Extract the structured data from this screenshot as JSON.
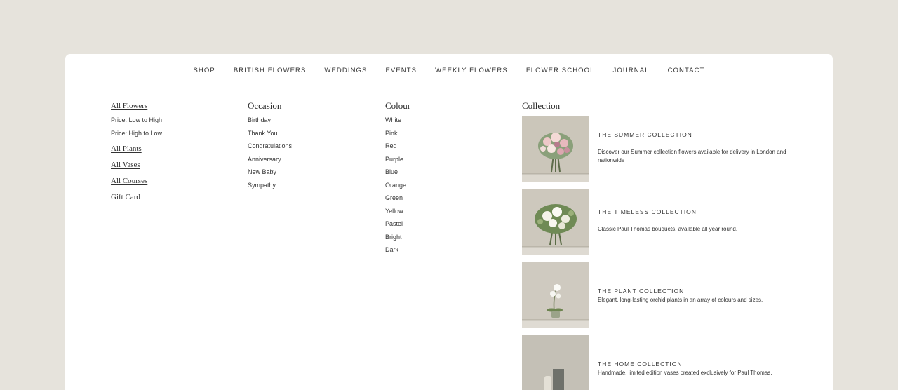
{
  "nav": [
    "SHOP",
    "BRITISH FLOWERS",
    "WEDDINGS",
    "EVENTS",
    "WEEKLY FLOWERS",
    "FLOWER SCHOOL",
    "JOURNAL",
    "CONTACT"
  ],
  "col1": {
    "all_flowers": "All Flowers",
    "sort": [
      "Price: Low to High",
      "Price: High to Low"
    ],
    "links": [
      "All Plants",
      "All Vases",
      "All Courses",
      "Gift Card"
    ]
  },
  "occasion": {
    "heading": "Occasion",
    "items": [
      "Birthday",
      "Thank You",
      "Congratulations",
      "Anniversary",
      "New Baby",
      "Sympathy"
    ]
  },
  "colour": {
    "heading": "Colour",
    "items": [
      "White",
      "Pink",
      "Red",
      "Purple",
      "Blue",
      "Orange",
      "Green",
      "Yellow",
      "Pastel",
      "Bright",
      "Dark"
    ]
  },
  "collection": {
    "heading": "Collection",
    "items": [
      {
        "title": "THE SUMMER COLLECTION",
        "desc": "Discover our Summer collection flowers available for delivery in London and nationwide"
      },
      {
        "title": "THE TIMELESS COLLECTION",
        "desc": "Classic Paul Thomas bouquets, available all year round."
      },
      {
        "title": "THE PLANT COLLECTION",
        "desc": "Elegant, long-lasting orchid plants in an array of colours and sizes."
      },
      {
        "title": "THE HOME COLLECTION",
        "desc": "Handmade, limited edition vases created exclusively for Paul Thomas."
      }
    ]
  },
  "colors": {
    "background": "#e6e3dc",
    "panel": "#ffffff",
    "text": "#2a2a2a",
    "photo_backdrop": "#c9c4b8"
  }
}
